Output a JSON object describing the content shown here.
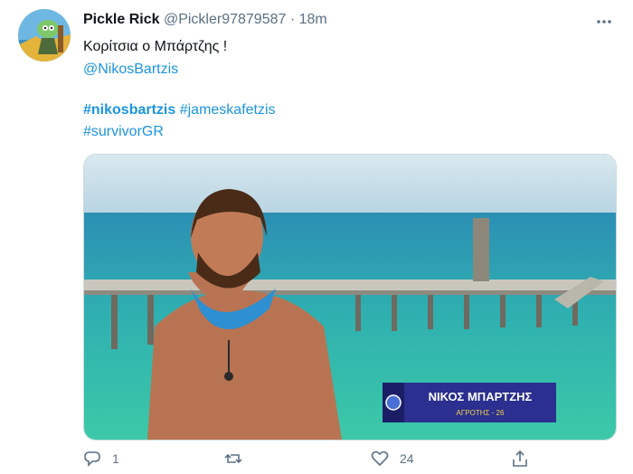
{
  "tweet": {
    "display_name": "Pickle Rick",
    "handle": "@Pickler97879587",
    "separator": "·",
    "time": "18m",
    "more_icon": "more-horizontal-icon",
    "text_line1": "Κορίτσια ο Μπάρτζης !",
    "mention": "@NikosBartzis",
    "hashtag1": "#nikosbartzis",
    "hashtag2": "#jameskafetzis",
    "hashtag3": "#survivorGR"
  },
  "media": {
    "caption_name": "ΝΙΚΟΣ ΜΠΑΡΤΖΗΣ",
    "caption_sub": "ΑΓΡΟΤΗΣ - 26"
  },
  "actions": {
    "reply_count": "1",
    "retweet_count": "",
    "like_count": "24",
    "share_icon": "share-icon"
  }
}
